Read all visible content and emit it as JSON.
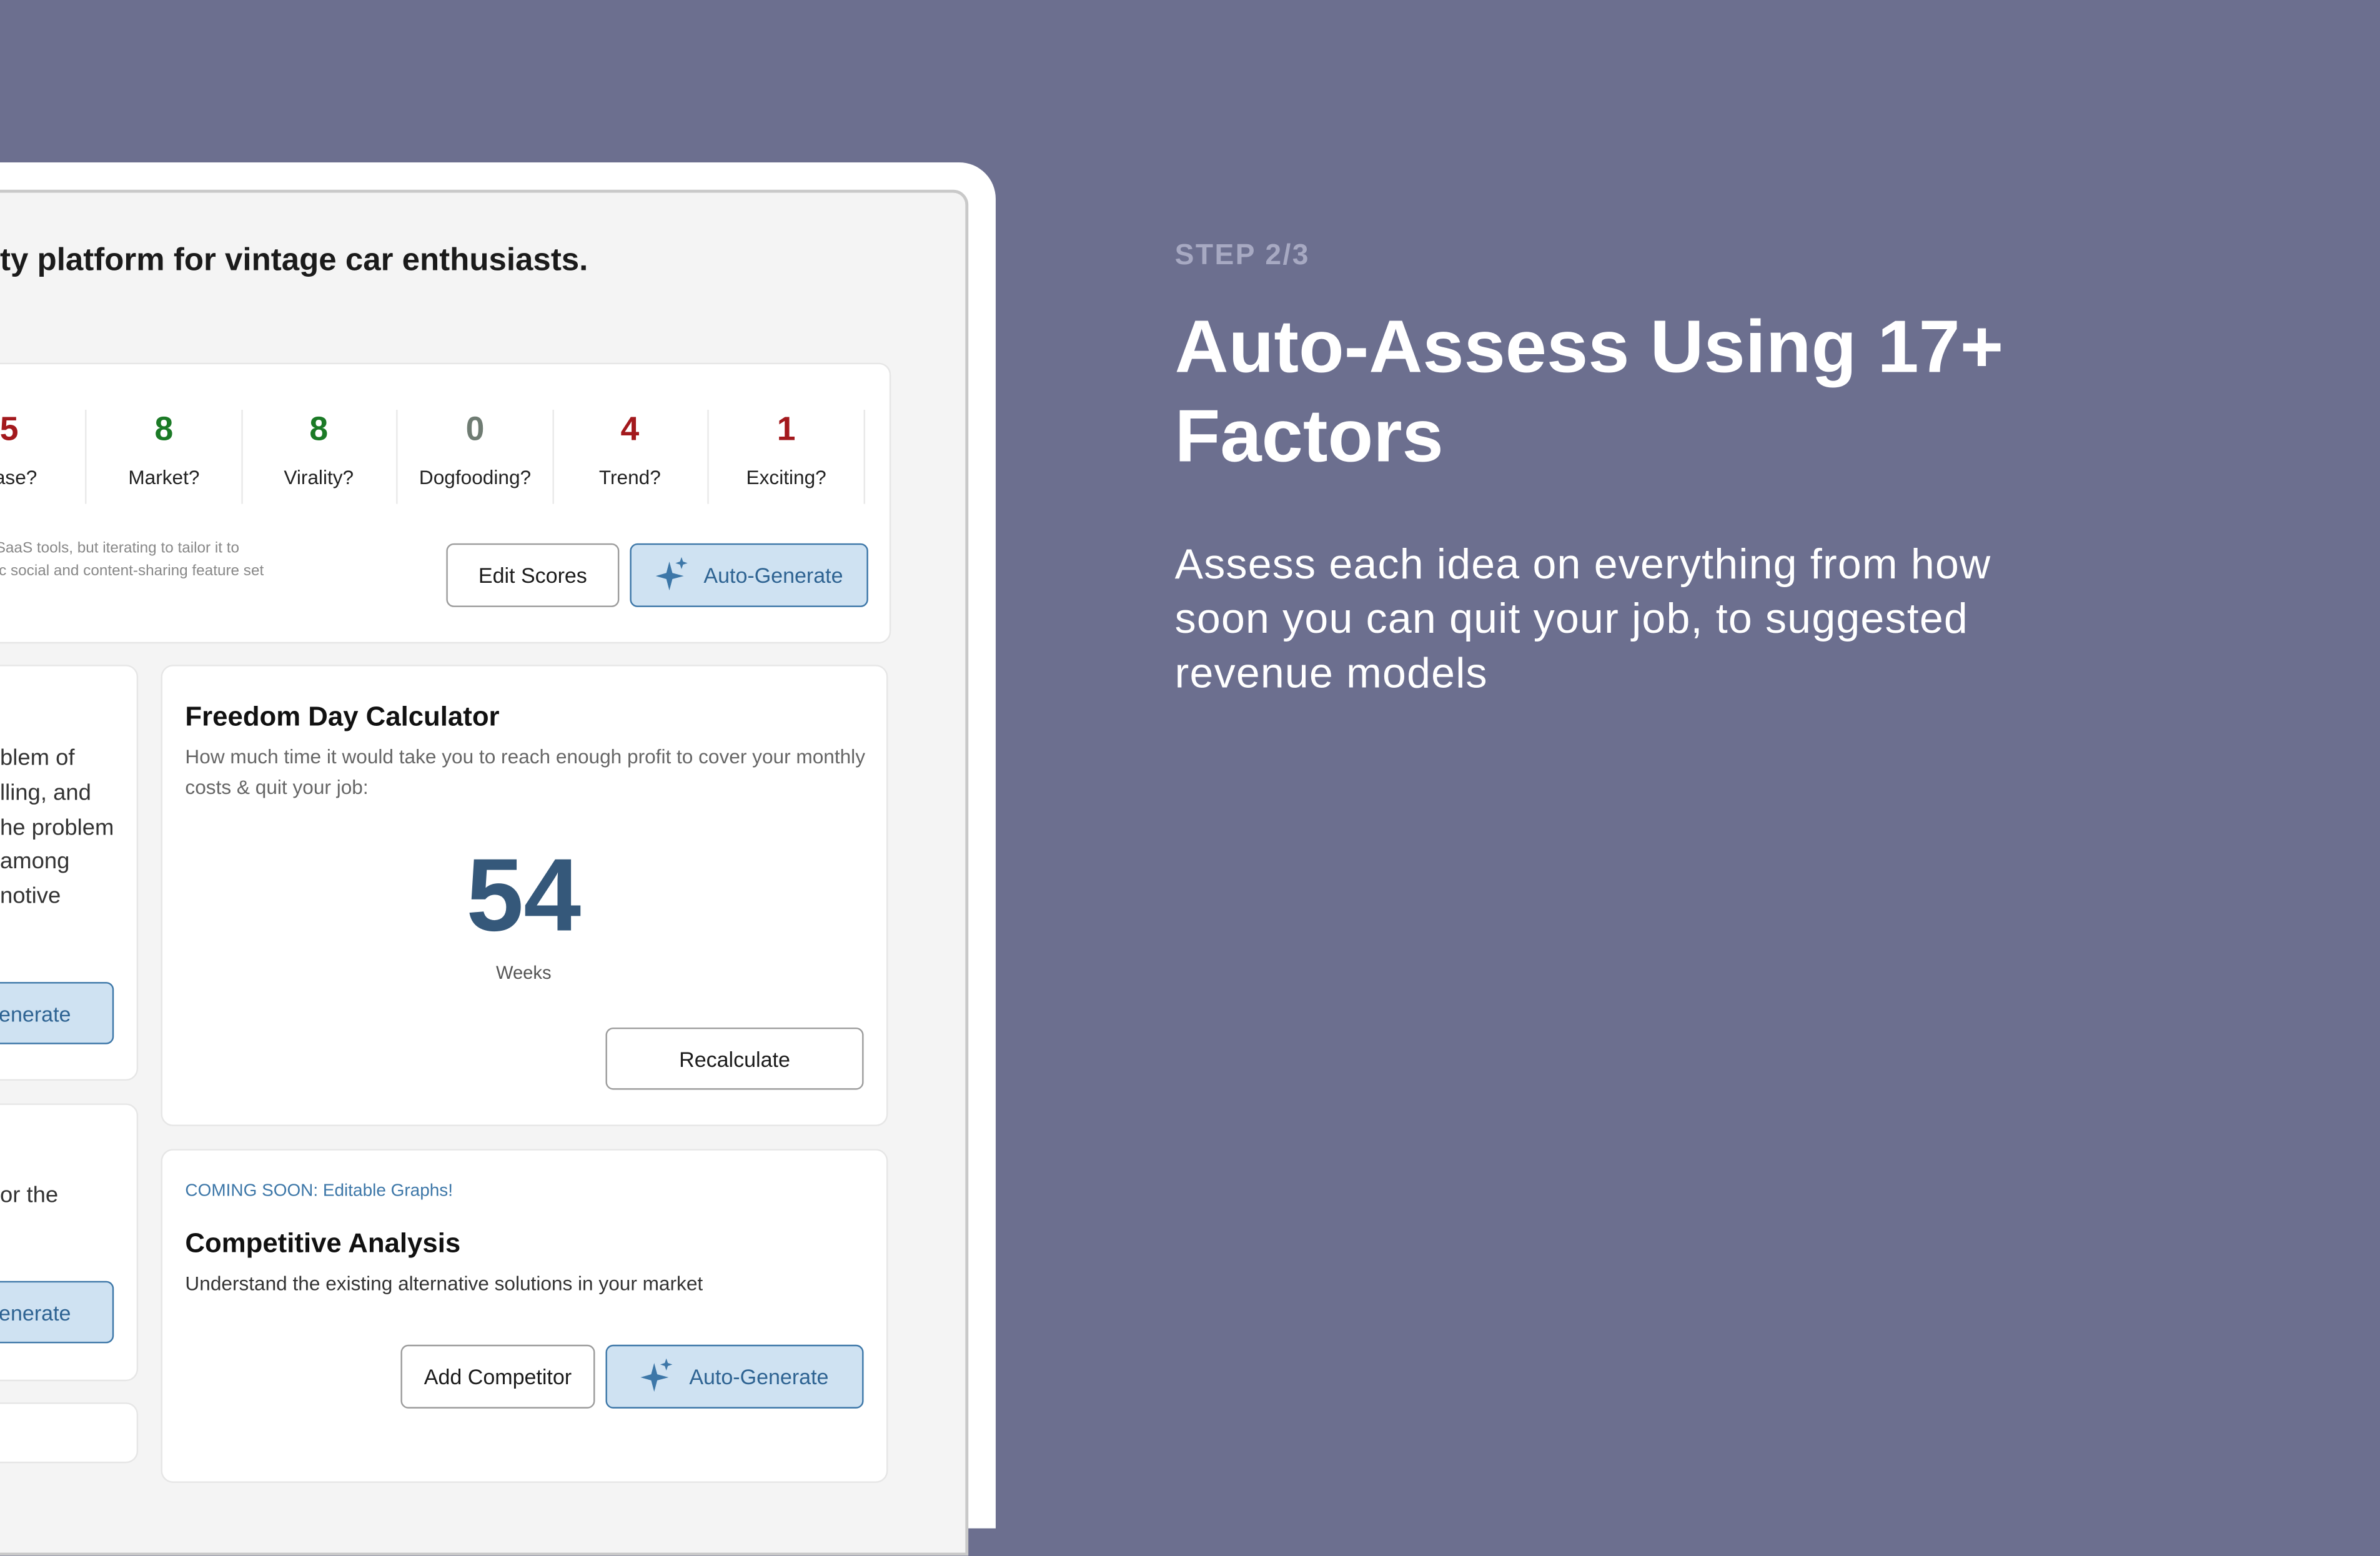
{
  "marketing": {
    "step": "STEP 2/3",
    "headline": "Auto-Assess Using 17+ Factors",
    "description": "Assess each idea on everything from how soon you can quit your job, to suggested revenue models"
  },
  "idea": {
    "title": "ty platform for vintage car enthusiasts."
  },
  "scores": [
    {
      "value": "5",
      "label": "Ease?",
      "color": "#a3191d"
    },
    {
      "value": "8",
      "label": "Market?",
      "color": "#1b7a26"
    },
    {
      "value": "8",
      "label": "Virality?",
      "color": "#1b7a26"
    },
    {
      "value": "0",
      "label": "Dogfooding?",
      "color": "#6f7c73"
    },
    {
      "value": "4",
      "label": "Trend?",
      "color": "#a3191d"
    },
    {
      "value": "1",
      "label": "Exciting?",
      "color": "#a3191d"
    }
  ],
  "score_note": [
    "SaaS tools, but iterating to tailor it to",
    "ic social and content-sharing feature set"
  ],
  "buttons": {
    "edit_scores": "Edit Scores",
    "auto_generate": "Auto-Generate",
    "partial_generate": "Generate",
    "recalculate": "Recalculate",
    "add_competitor": "Add Competitor"
  },
  "problem_card": {
    "lines": [
      "blem of",
      "lling, and",
      "he problem",
      "among",
      "notive"
    ]
  },
  "partial_card": {
    "line": "or the"
  },
  "freedom": {
    "title": "Freedom Day Calculator",
    "subtitle": "How much time it would take you to reach enough profit to cover your monthly costs & quit your job:",
    "value": "54",
    "unit": "Weeks"
  },
  "competitive": {
    "badge": "COMING SOON: Editable Graphs!",
    "title": "Competitive Analysis",
    "subtitle": "Understand the existing alternative solutions in your market"
  },
  "colors": {
    "background": "#6c6f8f",
    "accent_blue": "#2e6392",
    "button_blue_bg": "#cfe2f2",
    "freedom_number": "#35587a"
  }
}
